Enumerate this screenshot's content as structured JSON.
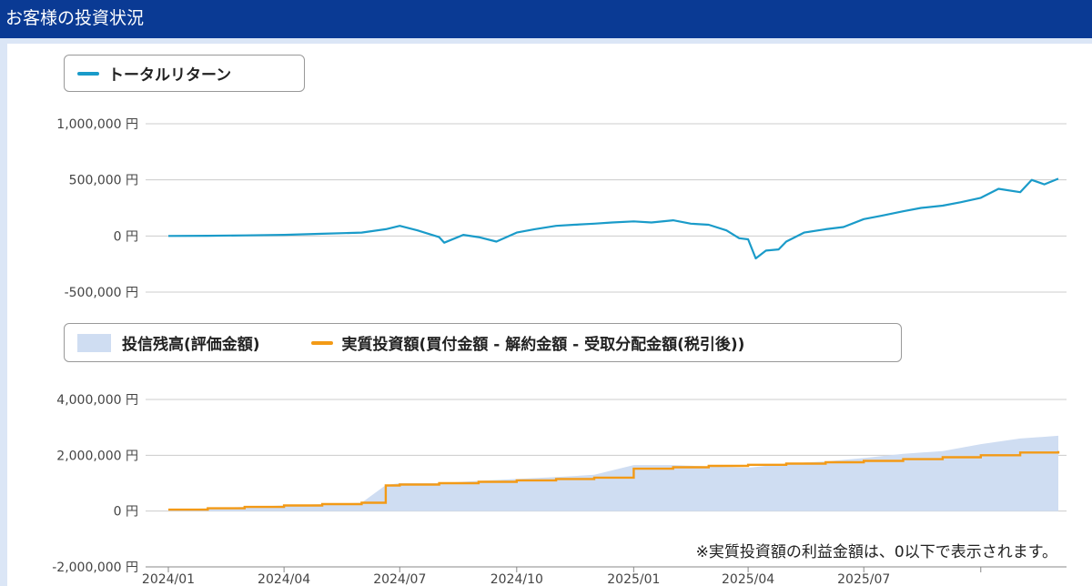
{
  "header": {
    "title": "お客様の投資状況"
  },
  "note": "※実質投資額の利益金額は、0以下で表示されます。",
  "colors": {
    "header": "#0a3a94",
    "total_return": "#1a9bc9",
    "balance_fill": "#cfddf2",
    "invested": "#f39a16",
    "grid": "#cccccc"
  },
  "chart_data": [
    {
      "type": "line",
      "legend": [
        "トータルリターン"
      ],
      "yticks": [
        "1,000,000 円",
        "500,000 円",
        "0 円",
        "-500,000 円"
      ],
      "ytick_values": [
        1000000,
        500000,
        0,
        -500000
      ],
      "ylim": [
        -500000,
        1000000
      ],
      "xlim": [
        "2024-01",
        "2025-11"
      ],
      "legend_position": "top-left",
      "grid": true,
      "series": [
        {
          "name": "トータルリターン",
          "color": "#1a9bc9",
          "x": [
            "2024-01",
            "2024-02",
            "2024-03",
            "2024-04",
            "2024-05",
            "2024-06",
            "2024-06-20",
            "2024-07",
            "2024-07-15",
            "2024-08",
            "2024-08-05",
            "2024-08-20",
            "2024-09",
            "2024-09-15",
            "2024-10",
            "2024-10-15",
            "2024-11",
            "2024-11-15",
            "2024-12",
            "2024-12-15",
            "2025-01",
            "2025-01-15",
            "2025-02",
            "2025-02-15",
            "2025-03",
            "2025-03-15",
            "2025-03-25",
            "2025-04",
            "2025-04-07",
            "2025-04-15",
            "2025-04-25",
            "2025-05",
            "2025-05-15",
            "2025-06",
            "2025-06-15",
            "2025-07",
            "2025-07-15",
            "2025-08",
            "2025-08-15",
            "2025-09",
            "2025-09-15",
            "2025-10",
            "2025-10-15",
            "2025-11",
            "2025-11-10",
            "2025-11-20",
            "2025-12"
          ],
          "values": [
            0,
            2000,
            5000,
            10000,
            20000,
            30000,
            60000,
            90000,
            50000,
            -10000,
            -60000,
            10000,
            -10000,
            -50000,
            30000,
            60000,
            90000,
            100000,
            110000,
            120000,
            130000,
            120000,
            140000,
            110000,
            100000,
            50000,
            -20000,
            -30000,
            -200000,
            -130000,
            -120000,
            -50000,
            30000,
            60000,
            80000,
            150000,
            180000,
            220000,
            250000,
            270000,
            300000,
            340000,
            420000,
            390000,
            500000,
            460000,
            510000
          ]
        }
      ]
    },
    {
      "type": "area",
      "legend": [
        "投信残高(評価金額)",
        "実質投資額(買付金額 - 解約金額 - 受取分配金額(税引後))"
      ],
      "yticks": [
        "4,000,000 円",
        "2,000,000 円",
        "0 円",
        "-2,000,000 円"
      ],
      "ytick_values": [
        4000000,
        2000000,
        0,
        -2000000
      ],
      "ylim": [
        -2000000,
        4000000
      ],
      "xticks": [
        "2024/01",
        "2024/04",
        "2024/07",
        "2024/10",
        "2025/01",
        "2025/04",
        "2025/07"
      ],
      "legend_position": "top-left",
      "grid": true,
      "series": [
        {
          "name": "投信残高(評価金額)",
          "type": "area",
          "color": "#cfddf2",
          "x": [
            "2024-01",
            "2024-02",
            "2024-03",
            "2024-04",
            "2024-05",
            "2024-06",
            "2024-06-20",
            "2024-07",
            "2024-08",
            "2024-09",
            "2024-10",
            "2024-11",
            "2024-12",
            "2025-01",
            "2025-02",
            "2025-03",
            "2025-04",
            "2025-05",
            "2025-06",
            "2025-07",
            "2025-08",
            "2025-09",
            "2025-10",
            "2025-11",
            "2025-12"
          ],
          "values": [
            50000,
            100000,
            150000,
            200000,
            250000,
            300000,
            930000,
            1000000,
            1000000,
            1080000,
            1150000,
            1220000,
            1300000,
            1650000,
            1650000,
            1600000,
            1550000,
            1700000,
            1780000,
            1900000,
            2050000,
            2150000,
            2400000,
            2600000,
            2700000
          ]
        },
        {
          "name": "実質投資額(買付金額 - 解約金額 - 受取分配金額(税引後))",
          "type": "step",
          "color": "#f39a16",
          "x": [
            "2024-01",
            "2024-02",
            "2024-03",
            "2024-04",
            "2024-05",
            "2024-06",
            "2024-06-20",
            "2024-07",
            "2024-08",
            "2024-09",
            "2024-10",
            "2024-11",
            "2024-12",
            "2025-01",
            "2025-02",
            "2025-03",
            "2025-04",
            "2025-05",
            "2025-06",
            "2025-07",
            "2025-08",
            "2025-09",
            "2025-10",
            "2025-11",
            "2025-12"
          ],
          "values": [
            50000,
            100000,
            150000,
            200000,
            250000,
            300000,
            920000,
            950000,
            1000000,
            1050000,
            1100000,
            1150000,
            1200000,
            1520000,
            1570000,
            1620000,
            1660000,
            1700000,
            1750000,
            1800000,
            1860000,
            1930000,
            2000000,
            2100000,
            2150000
          ]
        }
      ]
    }
  ]
}
